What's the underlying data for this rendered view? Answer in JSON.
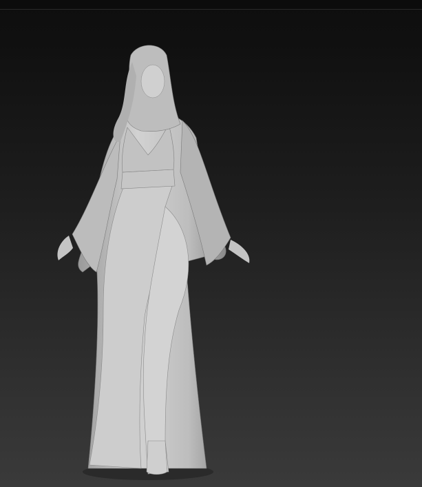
{
  "colors": {
    "background_top": "#0e0e0e",
    "background_bottom": "#3a3a3a",
    "model_clay": "#c9c9c9",
    "model_shadow": "#8e8e8e"
  }
}
